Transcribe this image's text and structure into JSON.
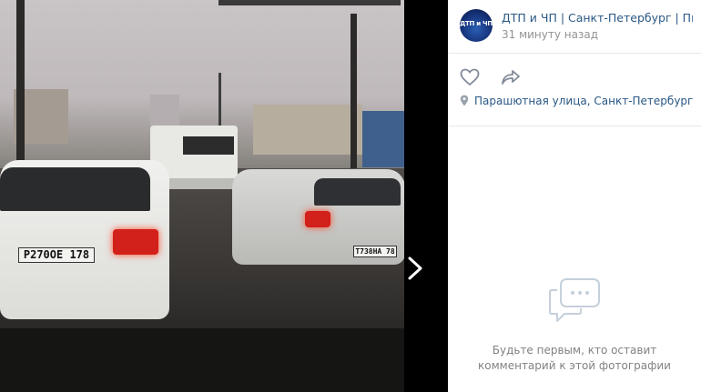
{
  "photo": {
    "plate_left": "P270OE 178",
    "plate_right": "T738HA 78",
    "next_icon": "chevron-right-icon"
  },
  "post": {
    "author": "ДТП и ЧП | Санкт-Петербург | Пи…",
    "time": "31 минуту назад",
    "avatar_text": "ДТП и ЧП",
    "location": "Парашютная улица, Санкт-Петербург"
  },
  "comments": {
    "empty_line1": "Будьте первым, кто оставит",
    "empty_line2": "комментарий к этой фотографии"
  },
  "colors": {
    "link": "#2a5885",
    "muted": "#939393",
    "background": "#000000"
  }
}
